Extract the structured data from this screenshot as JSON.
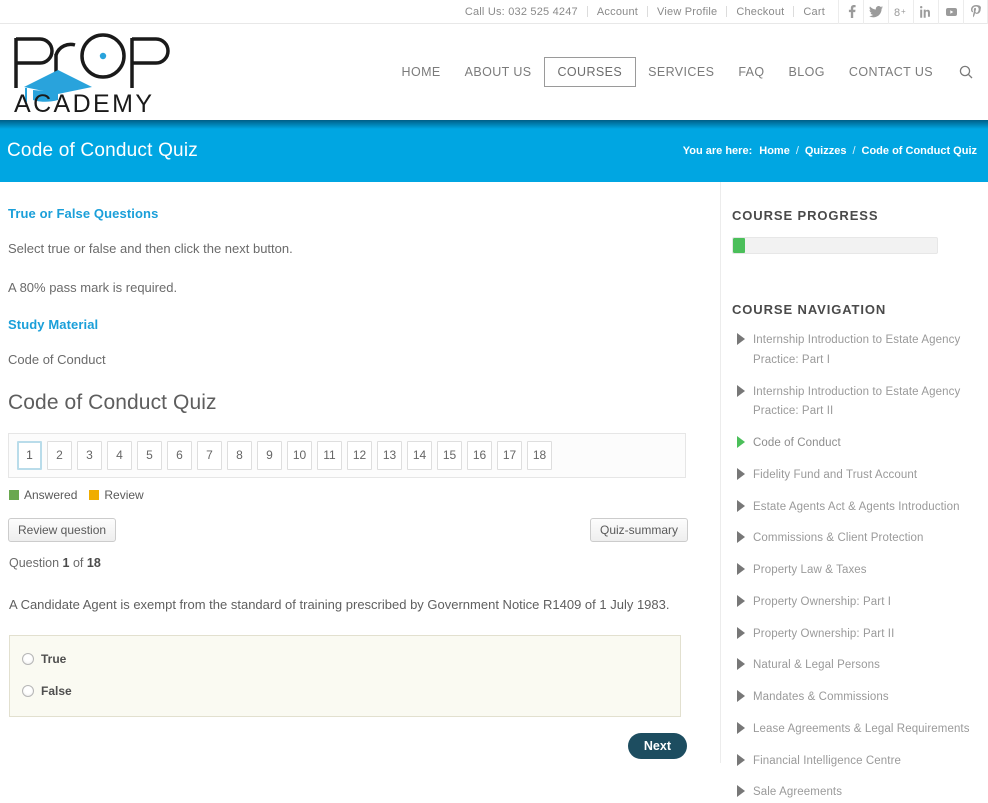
{
  "topbar": {
    "phone": "Call Us: 032 525 4247",
    "links": [
      "Account",
      "View Profile",
      "Checkout",
      "Cart"
    ],
    "social": [
      "facebook-icon",
      "twitter-icon",
      "googleplus-icon",
      "linkedin-icon",
      "youtube-icon",
      "pinterest-icon"
    ]
  },
  "header": {
    "logo_primary": "PROP",
    "logo_secondary": "ACADEMY",
    "nav": [
      {
        "label": "HOME",
        "active": false
      },
      {
        "label": "ABOUT US",
        "active": false
      },
      {
        "label": "COURSES",
        "active": true
      },
      {
        "label": "SERVICES",
        "active": false
      },
      {
        "label": "FAQ",
        "active": false
      },
      {
        "label": "BLOG",
        "active": false
      },
      {
        "label": "CONTACT US",
        "active": false
      }
    ],
    "search_icon": "search-icon"
  },
  "banner": {
    "title": "Code of Conduct Quiz",
    "breadcrumb_label": "You are here:",
    "breadcrumb": [
      "Home",
      "Quizzes",
      "Code of Conduct Quiz"
    ],
    "separator": "/",
    "bg_color": "#00a6e2"
  },
  "main": {
    "section_heading": "True or False Questions",
    "instruction": "Select true or false and then click the next button.",
    "pass_mark": "A 80% pass mark is required.",
    "study_material_heading": "Study Material",
    "study_material_item": "Code of Conduct",
    "quiz_title": "Code of Conduct Quiz",
    "question_numbers": [
      "1",
      "2",
      "3",
      "4",
      "5",
      "6",
      "7",
      "8",
      "9",
      "10",
      "11",
      "12",
      "13",
      "14",
      "15",
      "16",
      "17",
      "18"
    ],
    "current_question_index": 0,
    "legend": [
      {
        "label": "Answered",
        "color": "#6aa84f"
      },
      {
        "label": "Review",
        "color": "#f0ad00"
      }
    ],
    "review_button": "Review question",
    "summary_button": "Quiz-summary",
    "question_counter_prefix": "Question",
    "question_counter_current": "1",
    "question_counter_middle": "of",
    "question_counter_total": "18",
    "question_text": "A Candidate Agent is exempt from the standard of training prescribed by Government Notice R1409 of 1 July 1983.",
    "answers": [
      {
        "label": "True",
        "selected": false
      },
      {
        "label": "False",
        "selected": false
      }
    ],
    "next_button": "Next"
  },
  "sidebar": {
    "progress_heading": "COURSE PROGRESS",
    "progress_percent": 6,
    "progress_color": "#4bbf5a",
    "navigation_heading": "COURSE NAVIGATION",
    "items": [
      {
        "label": "Internship Introduction to Estate Agency Practice: Part I",
        "active": false
      },
      {
        "label": "Internship Introduction to Estate Agency Practice: Part II",
        "active": false
      },
      {
        "label": "Code of Conduct",
        "active": true
      },
      {
        "label": "Fidelity Fund and Trust Account",
        "active": false
      },
      {
        "label": "Estate Agents Act & Agents Introduction",
        "active": false
      },
      {
        "label": "Commissions & Client Protection",
        "active": false
      },
      {
        "label": "Property Law & Taxes",
        "active": false
      },
      {
        "label": "Property Ownership: Part I",
        "active": false
      },
      {
        "label": "Property Ownership: Part II",
        "active": false
      },
      {
        "label": "Natural & Legal Persons",
        "active": false
      },
      {
        "label": "Mandates & Commissions",
        "active": false
      },
      {
        "label": "Lease Agreements & Legal Requirements",
        "active": false
      },
      {
        "label": "Financial Intelligence Centre",
        "active": false
      },
      {
        "label": "Sale Agreements",
        "active": false
      }
    ]
  }
}
